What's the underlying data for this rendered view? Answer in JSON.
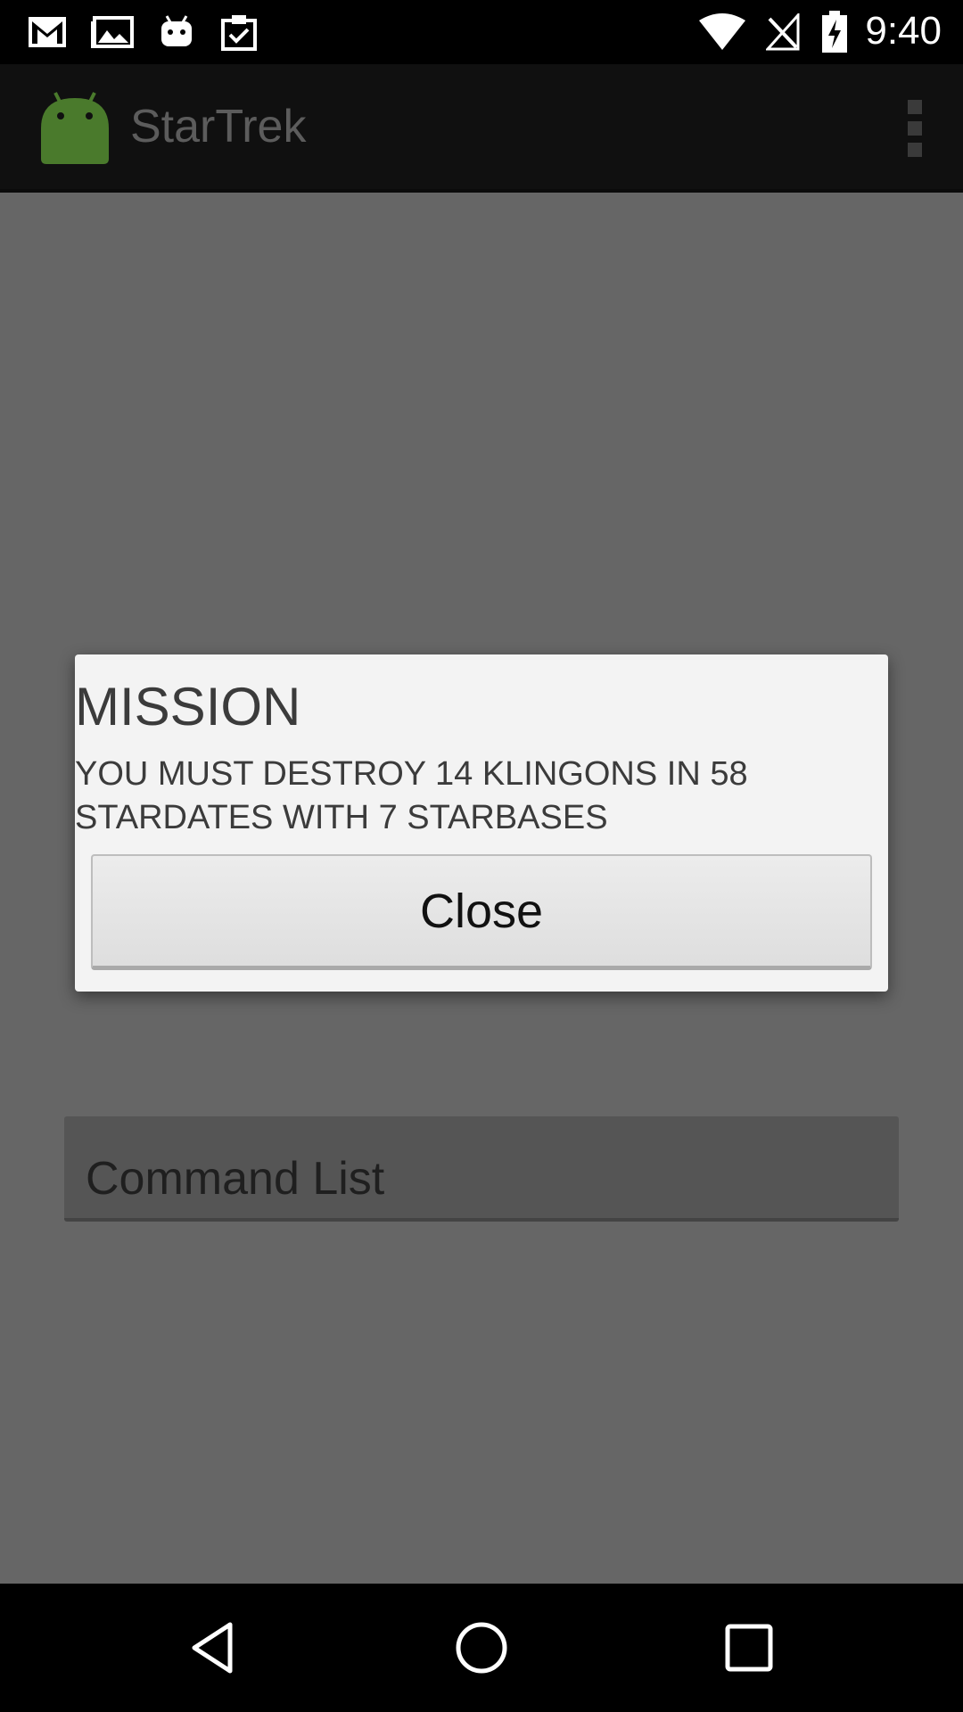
{
  "status_bar": {
    "time": "9:40",
    "icons": [
      "gmail-icon",
      "gallery-icon",
      "android-debug-icon",
      "clipboard-check-icon",
      "wifi-icon",
      "no-signal-icon",
      "battery-charging-icon"
    ]
  },
  "action_bar": {
    "app_icon": "android-icon",
    "title": "StarTrek",
    "overflow_icon": "overflow-menu-icon"
  },
  "main": {
    "command_list_label": "Command List"
  },
  "dialog": {
    "title": "MISSION",
    "message": "YOU MUST DESTROY 14 KLINGONS IN 58 STARDATES WITH 7 STARBASES",
    "close_label": "Close"
  },
  "nav_bar": {
    "icons": [
      "back-icon",
      "home-icon",
      "recents-icon"
    ]
  },
  "colors": {
    "dim_background": "#666666",
    "dialog_background": "#f3f3f3",
    "action_bar": "#101010",
    "android_green": "#4a7a2c"
  }
}
